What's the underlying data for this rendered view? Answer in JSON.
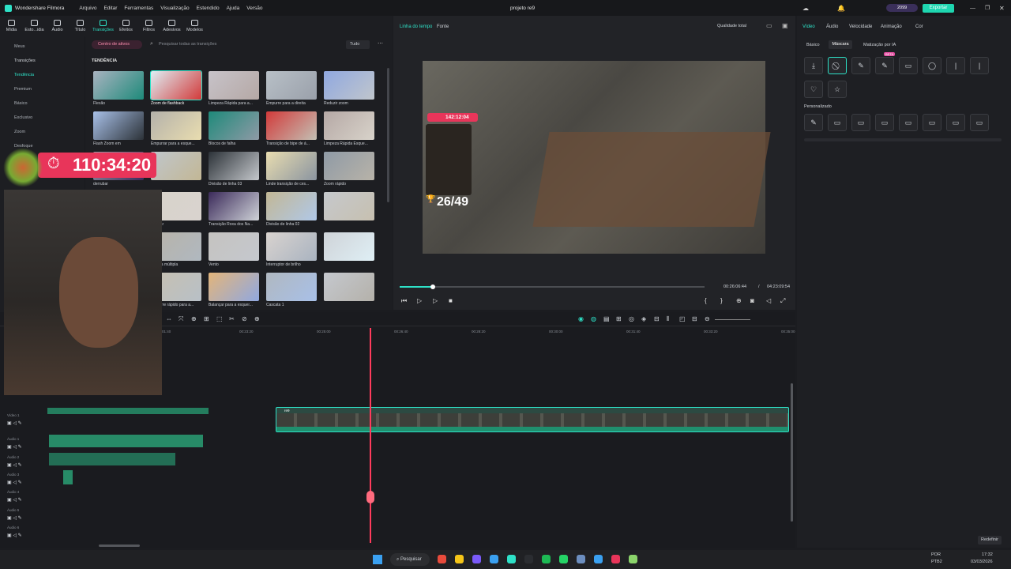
{
  "app": {
    "name": "Wondershare Filmora",
    "project": "projeto re9",
    "menu": [
      "Arquivo",
      "Editar",
      "Ferramentas",
      "Visualização",
      "Estendido",
      "Ajuda",
      "Versão"
    ],
    "credits": "2099",
    "export": "Exportar"
  },
  "toolbar": {
    "items": [
      "Mídia",
      "Esto...idia",
      "Áudio",
      "Título",
      "Transições",
      "Efeitos",
      "Filtros",
      "Adesivos",
      "Modelos"
    ],
    "active_index": 4
  },
  "sidebar": {
    "items": [
      "Meus",
      "Transições",
      "Tendência",
      "Premium",
      "Básico",
      "Exclusivo",
      "Zoom",
      "Desfoque"
    ]
  },
  "browser": {
    "assets_center": "Centro de ativos",
    "search_placeholder": "Pesquisar todas as transições",
    "filter": "Tudo",
    "section_title": "TENDÊNCIA",
    "tiles": [
      "Flexão",
      "Zoom de flashback",
      "Limpeza Rápida para a...",
      "Empurre para a direita",
      "Reduzir zoom",
      "Flash Zoom em",
      "Empurrar para a esque...",
      "Blocos de falha",
      "Transição de bipe de á...",
      "Limpeza Rápida Esque...",
      "derrubar",
      "",
      "Divisão de linha 03",
      "Linde transição de ces...",
      "Zoom rápido",
      "rápido",
      "Apagar",
      "Transição Roxa dos Na...",
      "Divisão de linha 02",
      "",
      "de lente",
      "Panela múltipla",
      "Vento",
      "Interruptor de brilho",
      "",
      "flash rápido",
      "Empurre rápido para a...",
      "Balançar para a esquer...",
      "Cascata 1",
      ""
    ],
    "new_badge": "Novo"
  },
  "overlay": {
    "timer": "110:34:20",
    "stream_timer": "142:12:04",
    "counter": "26/49"
  },
  "preview": {
    "tabs": [
      "Linha do tempo",
      "Fonte"
    ],
    "quality": "Qualidade total",
    "current_time": "00:26:06:44",
    "total_time": "04:23:09:54",
    "progress": 0.11
  },
  "props": {
    "tabs": [
      "Vídeo",
      "Áudio",
      "Velocidade",
      "Animação",
      "Cor"
    ],
    "subtabs": [
      "Básico",
      "Máscara",
      "Matização por IA"
    ],
    "beta": "BETA",
    "custom_label": "Personalizado",
    "reset": "Redefinir"
  },
  "timeline": {
    "ruler": [
      "01:40",
      "00:23:20",
      "00:25:00",
      "00:26:40",
      "00:28:20",
      "00:30:00",
      "00:31:40",
      "00:33:20",
      "00:35:00"
    ],
    "tracks": [
      "Vídeo 1",
      "Áudio 1",
      "Áudio 2",
      "Áudio 3",
      "Áudio 4",
      "Áudio 5",
      "Áudio 6"
    ],
    "clip_name": "re9",
    "playhead_progress": 0.47
  },
  "taskbar": {
    "search": "Pesquisar",
    "lang": "POR",
    "layout": "PTB2",
    "time": "17:32",
    "date": "03/03/2026"
  },
  "colors": {
    "accent": "#2ee1c7",
    "export": "#1ed6b0",
    "playhead": "#ff3b5c",
    "clip": "#1f8f6e"
  }
}
